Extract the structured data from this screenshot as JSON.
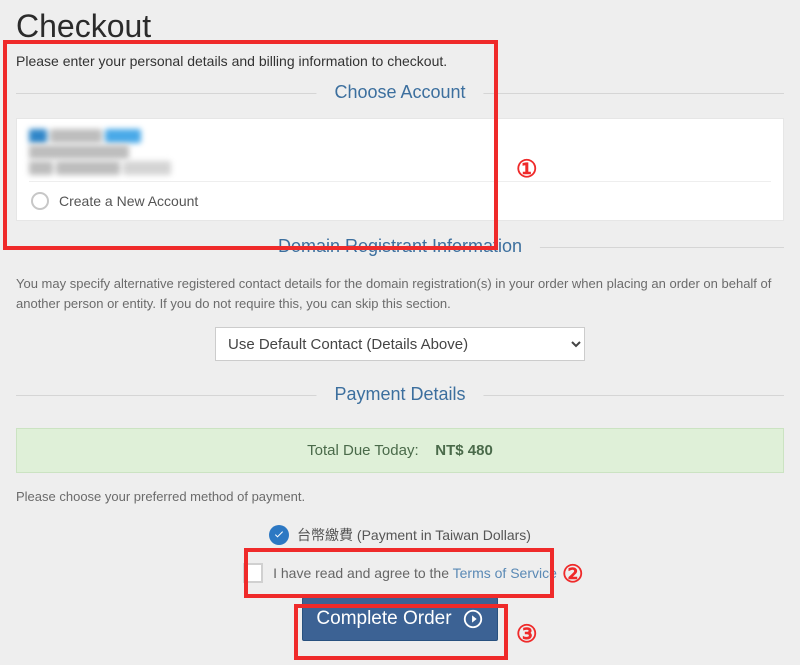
{
  "page": {
    "title": "Checkout",
    "subtitle": "Please enter your personal details and billing information to checkout."
  },
  "choose_account": {
    "heading": "Choose Account",
    "new_account_label": "Create a New Account"
  },
  "registrant": {
    "heading": "Domain Registrant Information",
    "blurb": "You may specify alternative registered contact details for the domain registration(s) in your order when placing an order on behalf of another person or entity. If you do not require this, you can skip this section.",
    "select_value": "Use Default Contact (Details Above)"
  },
  "payment": {
    "heading": "Payment Details",
    "total_label": "Total Due Today:",
    "total_value": "NT$ 480",
    "choose_method_hint": "Please choose your preferred method of payment.",
    "method_label": "台幣繳費 (Payment in Taiwan Dollars)"
  },
  "agree": {
    "lead": "I have read and agree to the ",
    "link": "Terms of Service"
  },
  "submit": {
    "label": "Complete Order"
  },
  "annotations": {
    "one": "①",
    "two": "②",
    "three": "③"
  }
}
